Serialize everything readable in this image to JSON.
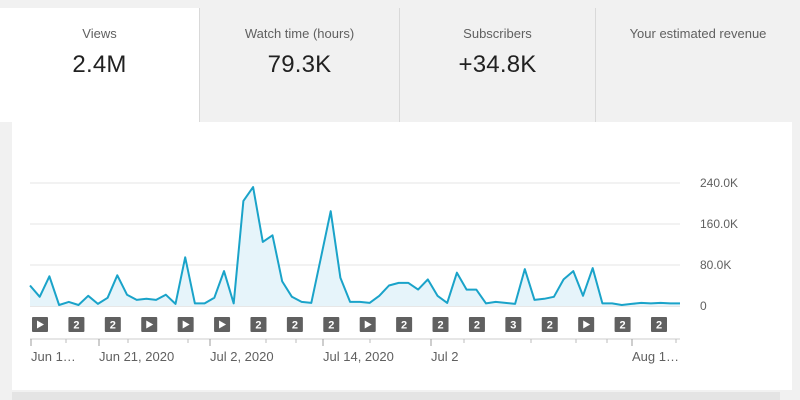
{
  "tabs": [
    {
      "label": "Views",
      "value": "2.4M"
    },
    {
      "label": "Watch time (hours)",
      "value": "79.3K"
    },
    {
      "label": "Subscribers",
      "value": "+34.8K"
    },
    {
      "label": "Your estimated revenue",
      "value": ""
    }
  ],
  "colors": {
    "line": "#1aa3c9",
    "fill": "#e6f4fa",
    "grid": "#e6e6e6",
    "marker": "#606060"
  },
  "chart_data": {
    "type": "area",
    "y_tick_labels": [
      "240.0K",
      "160.0K",
      "80.0K",
      "0"
    ],
    "y_ticks": [
      240000,
      160000,
      80000,
      0
    ],
    "ylim": [
      0,
      260000
    ],
    "x_tick_labels": [
      "Jun 1…",
      "Jun 21, 2020",
      "Jul 2, 2020",
      "Jul 14, 2020",
      "Jul 2",
      "Aug 1…"
    ],
    "grid": true,
    "series": [
      {
        "values": [
          40000,
          18000,
          58000,
          2000,
          8000,
          2000,
          20000,
          4000,
          16000,
          60000,
          22000,
          12000,
          14000,
          12000,
          22000,
          4000,
          95000,
          5000,
          5000,
          16000,
          68000,
          5000,
          205000,
          232000,
          125000,
          138000,
          48000,
          18000,
          8000,
          6000,
          95000,
          185000,
          55000,
          8000,
          8000,
          6000,
          20000,
          40000,
          45000,
          45000,
          32000,
          52000,
          20000,
          6000,
          65000,
          32000,
          32000,
          5000,
          8000,
          6000,
          4000,
          72000,
          12000,
          14000,
          18000,
          52000,
          68000,
          20000,
          74000,
          5000,
          5000,
          2000,
          4000,
          6000,
          5000,
          6000,
          5000,
          5000
        ]
      }
    ],
    "markers": [
      "play",
      "2",
      "2",
      "play",
      "play",
      "play",
      "2",
      "2",
      "2",
      "play",
      "2",
      "2",
      "2",
      "3",
      "2",
      "play",
      "2",
      "2"
    ]
  }
}
